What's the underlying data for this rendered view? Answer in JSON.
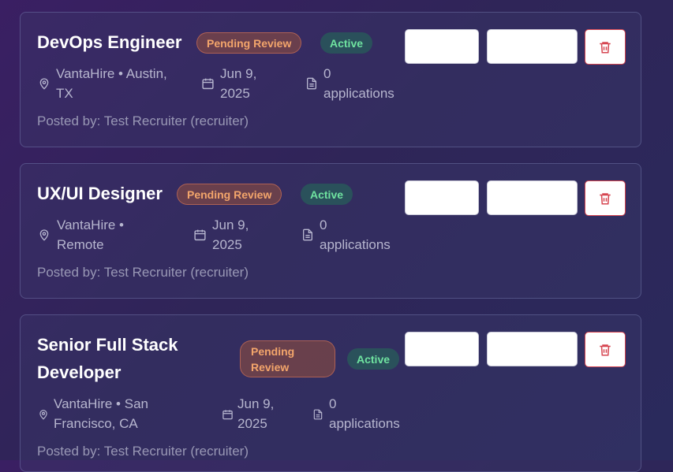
{
  "jobs": [
    {
      "title_lines": [
        "DevOps Engineer"
      ],
      "status_badge": "Pending Review",
      "active_badge": "Active",
      "company_location": [
        "VantaHire • Austin,",
        "TX"
      ],
      "date": [
        "Jun 9,",
        "2025"
      ],
      "applications": [
        "0",
        "applications"
      ],
      "posted_by": "Posted by: Test Recruiter (recruiter)"
    },
    {
      "title_lines": [
        "UX/UI Designer"
      ],
      "status_badge": "Pending Review",
      "active_badge": "Active",
      "company_location": [
        "VantaHire •",
        "Remote"
      ],
      "date": [
        "Jun 9,",
        "2025"
      ],
      "applications": [
        "0",
        "applications"
      ],
      "posted_by": "Posted by: Test Recruiter (recruiter)"
    },
    {
      "title_lines": [
        "Senior Full Stack",
        "Developer"
      ],
      "status_badge_lines": [
        "Pending",
        "Review"
      ],
      "active_badge": "Active",
      "company_location": [
        "VantaHire • San",
        "Francisco, CA"
      ],
      "date": [
        "Jun 9,",
        "2025"
      ],
      "applications": [
        "0",
        "applications"
      ],
      "posted_by": "Posted by: Test Recruiter (recruiter)"
    }
  ],
  "icons": {
    "location": "map-pin-icon",
    "date": "calendar-icon",
    "applications": "document-icon",
    "delete": "trash-icon"
  },
  "colors": {
    "pending_text": "#f3a56b",
    "active_text": "#6fe3a0",
    "delete_red": "#d64550"
  }
}
